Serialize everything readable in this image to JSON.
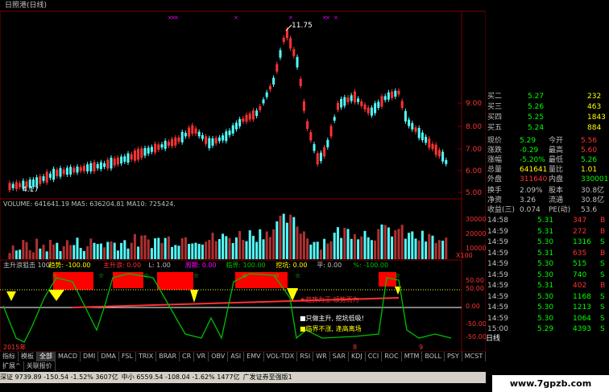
{
  "window": {
    "title": "日照港(日线)"
  },
  "price_chart": {
    "high_label": "11.75",
    "low_label": "4.17",
    "axis_ticks": [
      "9.00",
      "8.00",
      "7.00",
      "6.00",
      "5.00"
    ],
    "x_label": "2015年",
    "x_label_right": "8",
    "x_label_right2": "9"
  },
  "volume": {
    "title": "VOLUME: 641641.19  MA5: 636204.81  MA10: 725424.",
    "axis_ticks": [
      "30000",
      "20000",
      "10000"
    ],
    "unit": "X100"
  },
  "indicator": {
    "title_parts": [
      "主升浪狙击 100",
      "趋势: -100.00",
      "主升浪: 0.00",
      "L: 1.00",
      "周期: 0.00",
      "临界: 100.00",
      "挖坑: 0.00",
      "平: 0.00",
      "%: -100.00"
    ],
    "axis_ticks": [
      "50.00",
      "50.00",
      "0.00",
      "-50.00",
      "-50.00"
    ],
    "annotations": [
      "★趋势为王 顺势而为",
      "■只做主升, 挖坑低吸!",
      "■临界不涨, 逢高离场"
    ]
  },
  "quote": {
    "asks": [
      {
        "label": "买二",
        "price": "5.27",
        "vol": "232"
      },
      {
        "label": "买三",
        "price": "5.26",
        "vol": "463"
      },
      {
        "label": "买四",
        "price": "5.25",
        "vol": "1843"
      },
      {
        "label": "买五",
        "price": "5.24",
        "vol": "884"
      }
    ],
    "stats": [
      {
        "l1": "现价",
        "v1": "5.29",
        "l2": "今开",
        "v2": "5.56"
      },
      {
        "l1": "涨跌",
        "v1": "-0.29",
        "l2": "最高",
        "v2": "5.60"
      },
      {
        "l1": "涨幅",
        "v1": "-5.20%",
        "l2": "最低",
        "v2": "5.26"
      },
      {
        "l1": "总量",
        "v1": "641641",
        "l2": "量比",
        "v2": "1.01"
      },
      {
        "l1": "外盘",
        "v1": "311640",
        "l2": "内盘",
        "v2": "330001"
      },
      {
        "l1": "换手",
        "v1": "2.09%",
        "l2": "股本",
        "v2": "30.8亿"
      },
      {
        "l1": "净资",
        "v1": "3.26",
        "l2": "流通",
        "v2": "30.8亿"
      },
      {
        "l1": "收益(三)",
        "v1": "0.074",
        "l2": "PE(动)",
        "v2": "53.6"
      }
    ],
    "ticks": [
      {
        "t": "14:58",
        "p": "5.31",
        "v": "347",
        "d": "B"
      },
      {
        "t": "14:59",
        "p": "5.31",
        "v": "272",
        "d": "B"
      },
      {
        "t": "14:59",
        "p": "5.30",
        "v": "1316",
        "d": "S"
      },
      {
        "t": "14:59",
        "p": "5.31",
        "v": "635",
        "d": "B"
      },
      {
        "t": "14:59",
        "p": "5.30",
        "v": "515",
        "d": "S"
      },
      {
        "t": "14:59",
        "p": "5.30",
        "v": "740",
        "d": "S"
      },
      {
        "t": "14:59",
        "p": "5.31",
        "v": "402",
        "d": "B"
      },
      {
        "t": "14:59",
        "p": "5.30",
        "v": "1168",
        "d": "S"
      },
      {
        "t": "14:59",
        "p": "5.30",
        "v": "1213",
        "d": "S"
      },
      {
        "t": "14:59",
        "p": "5.30",
        "v": "1064",
        "d": "S"
      },
      {
        "t": "15:00",
        "p": "5.29",
        "v": "4393",
        "d": "S"
      }
    ],
    "bottom_tab": "日线"
  },
  "tabs": [
    "指标",
    "模板",
    "全部",
    "MACD",
    "DMI",
    "DMA",
    "FSL",
    "TRIX",
    "BRAR",
    "CR",
    "VR",
    "OBV",
    "ASI",
    "EMV",
    "VOL-TDX",
    "RSI",
    "WR",
    "SAR",
    "KDJ",
    "CCI",
    "ROC",
    "MTM",
    "BOLL",
    "PSY",
    "MCST"
  ],
  "subtabs": [
    "扩展^",
    "关联报价"
  ],
  "statusbar": {
    "items": [
      "深证 9739.89 -150.54 -1.52% 3607亿",
      "中小 6559.54 -108.04 -1.62% 1477亿",
      "广发证券至强版1"
    ]
  },
  "watermark": "www.7gpzb.com",
  "colors": {
    "up": "#ff3232",
    "down": "#54fcfc",
    "ma": "#ffffff",
    "indicator_fill": "#ff0000",
    "yellow": "#ffff00",
    "green": "#00c000"
  }
}
